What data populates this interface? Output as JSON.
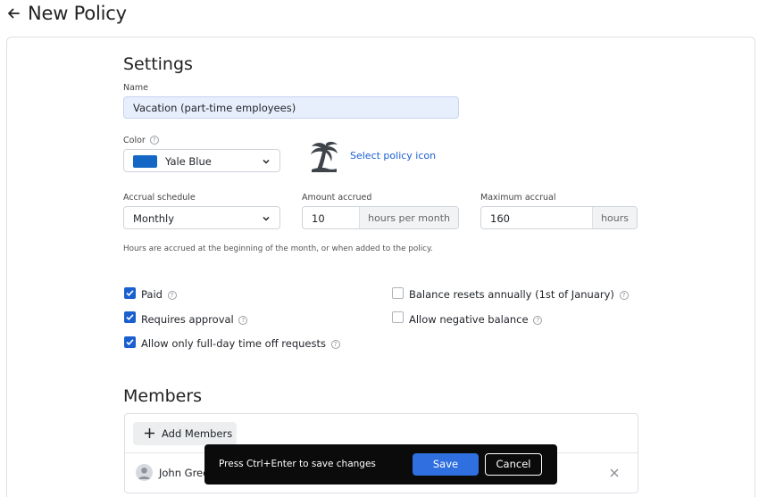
{
  "header": {
    "title": "New Policy"
  },
  "settings": {
    "heading": "Settings",
    "name_label": "Name",
    "name_value": "Vacation (part-time employees)",
    "color_label": "Color",
    "color_value": "Yale Blue",
    "color_hex": "#1467c4",
    "icon_link": "Select policy icon",
    "accrual_label": "Accrual schedule",
    "accrual_value": "Monthly",
    "amount_label": "Amount accrued",
    "amount_value": "10",
    "amount_suffix": "hours per month",
    "max_label": "Maximum accrual",
    "max_value": "160",
    "max_suffix": "hours",
    "hint": "Hours are accrued at the beginning of the month, or when added to the policy."
  },
  "options": [
    {
      "label": "Paid",
      "checked": true
    },
    {
      "label": "Requires approval",
      "checked": true
    },
    {
      "label": "Allow only full-day time off requests",
      "checked": true
    },
    {
      "label": "Balance resets annually (1st of January)",
      "checked": false
    },
    {
      "label": "Allow negative balance",
      "checked": false
    }
  ],
  "members": {
    "heading": "Members",
    "add_label": "Add Members",
    "list": [
      {
        "name": "John Gree"
      }
    ]
  },
  "toast": {
    "message": "Press Ctrl+Enter to save changes",
    "save_label": "Save",
    "cancel_label": "Cancel"
  },
  "colors": {
    "accent": "#2f6fdf",
    "link": "#1a5fd0",
    "toast_bg": "#0b0b0c"
  }
}
